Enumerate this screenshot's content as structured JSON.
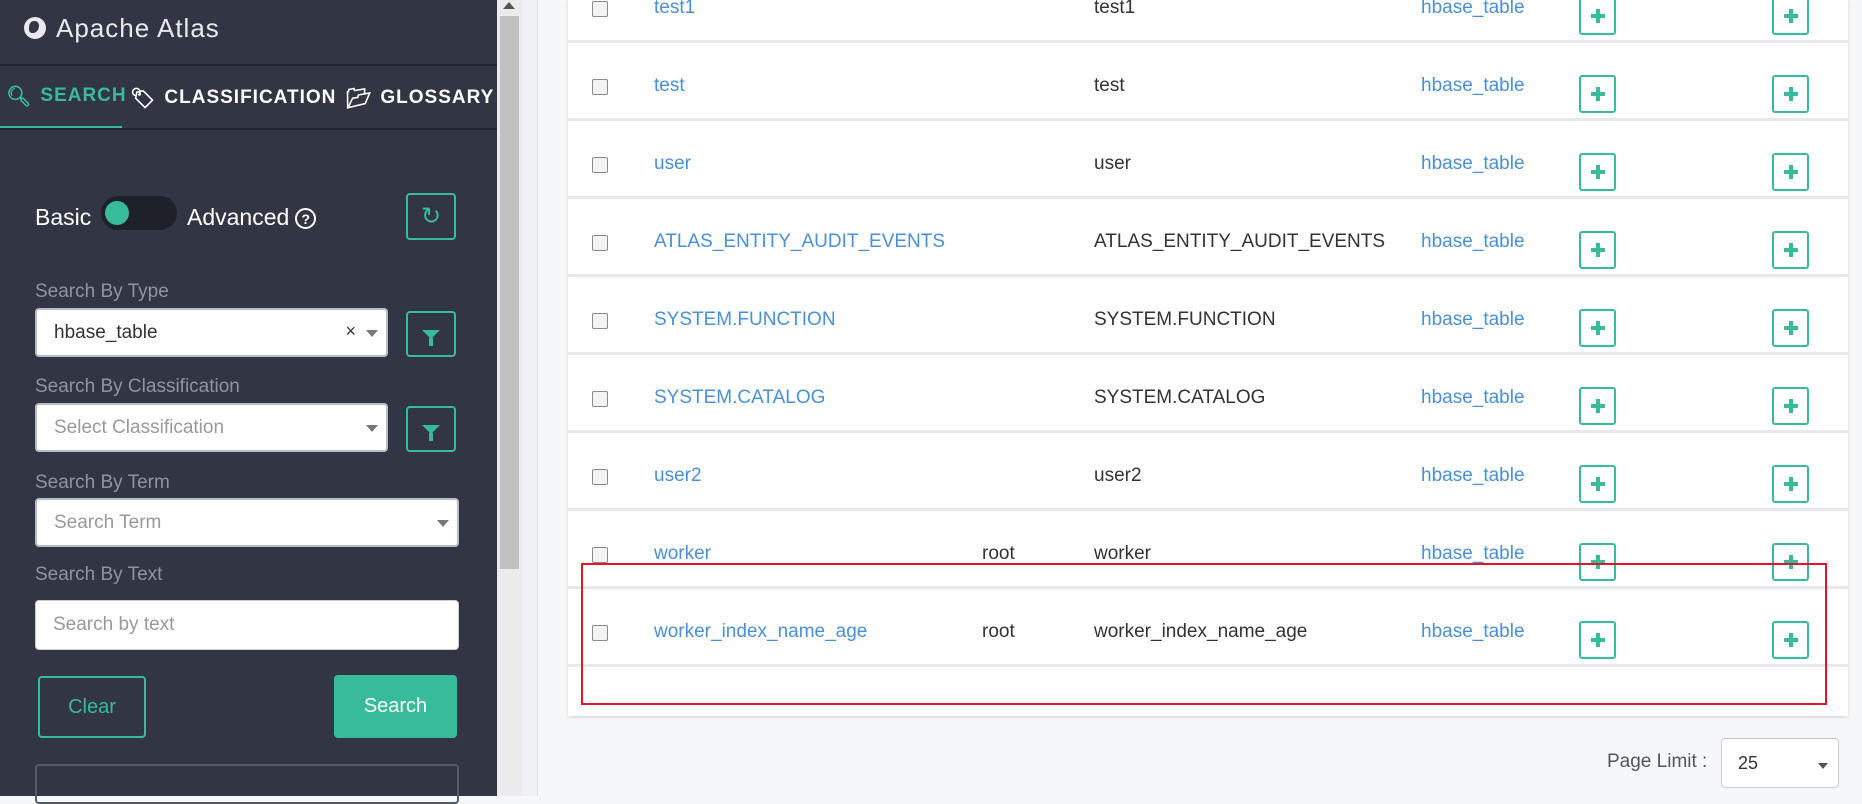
{
  "app": {
    "title": "Apache Atlas"
  },
  "tabs": [
    {
      "label": "SEARCH",
      "icon": "search-icon",
      "active": true
    },
    {
      "label": "CLASSIFICATION",
      "icon": "tags-icon",
      "active": false
    },
    {
      "label": "GLOSSARY",
      "icon": "folder-open-icon",
      "active": false
    }
  ],
  "search": {
    "toggle_basic": "Basic",
    "toggle_advanced": "Advanced",
    "help_glyph": "?",
    "type_label": "Search By Type",
    "type_value": "hbase_table",
    "type_clear": "×",
    "classification_label": "Search By Classification",
    "classification_placeholder": "Select Classification",
    "term_label": "Search By Term",
    "term_placeholder": "Search Term",
    "text_label": "Search By Text",
    "text_placeholder": "Search by text",
    "clear_label": "Clear",
    "search_label": "Search"
  },
  "table": {
    "rows": [
      {
        "name": "test1",
        "owner": "",
        "qualified": "test1",
        "type": "hbase_table"
      },
      {
        "name": "test",
        "owner": "",
        "qualified": "test",
        "type": "hbase_table"
      },
      {
        "name": "user",
        "owner": "",
        "qualified": "user",
        "type": "hbase_table"
      },
      {
        "name": "ATLAS_ENTITY_AUDIT_EVENTS",
        "owner": "",
        "qualified": "ATLAS_ENTITY_AUDIT_EVENTS",
        "type": "hbase_table"
      },
      {
        "name": "SYSTEM.FUNCTION",
        "owner": "",
        "qualified": "SYSTEM.FUNCTION",
        "type": "hbase_table"
      },
      {
        "name": "SYSTEM.CATALOG",
        "owner": "",
        "qualified": "SYSTEM.CATALOG",
        "type": "hbase_table"
      },
      {
        "name": "user2",
        "owner": "",
        "qualified": "user2",
        "type": "hbase_table"
      },
      {
        "name": "worker",
        "owner": "root",
        "qualified": "worker",
        "type": "hbase_table"
      },
      {
        "name": "worker_index_name_age",
        "owner": "root",
        "qualified": "worker_index_name_age",
        "type": "hbase_table"
      }
    ]
  },
  "pagination": {
    "label": "Page Limit :",
    "value": "25"
  },
  "colors": {
    "accent": "#38bb9b",
    "sidebar": "#323544",
    "link": "#4a90d9",
    "highlight": "#e0162b"
  }
}
